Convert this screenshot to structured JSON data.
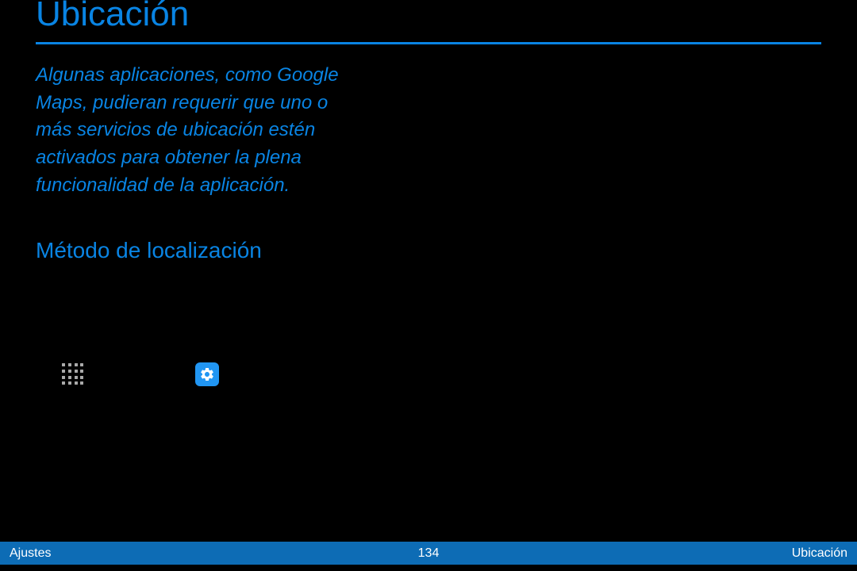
{
  "page": {
    "title": "Ubicación",
    "intro": "Algunas aplicaciones, como Google Maps, pudieran requerir que uno o más servicios de ubicación estén activados para obtener la plena funcionalidad de la aplicación.",
    "sectionHeading": "Método de localización"
  },
  "footer": {
    "left": "Ajustes",
    "center": "134",
    "right": "Ubicación"
  }
}
